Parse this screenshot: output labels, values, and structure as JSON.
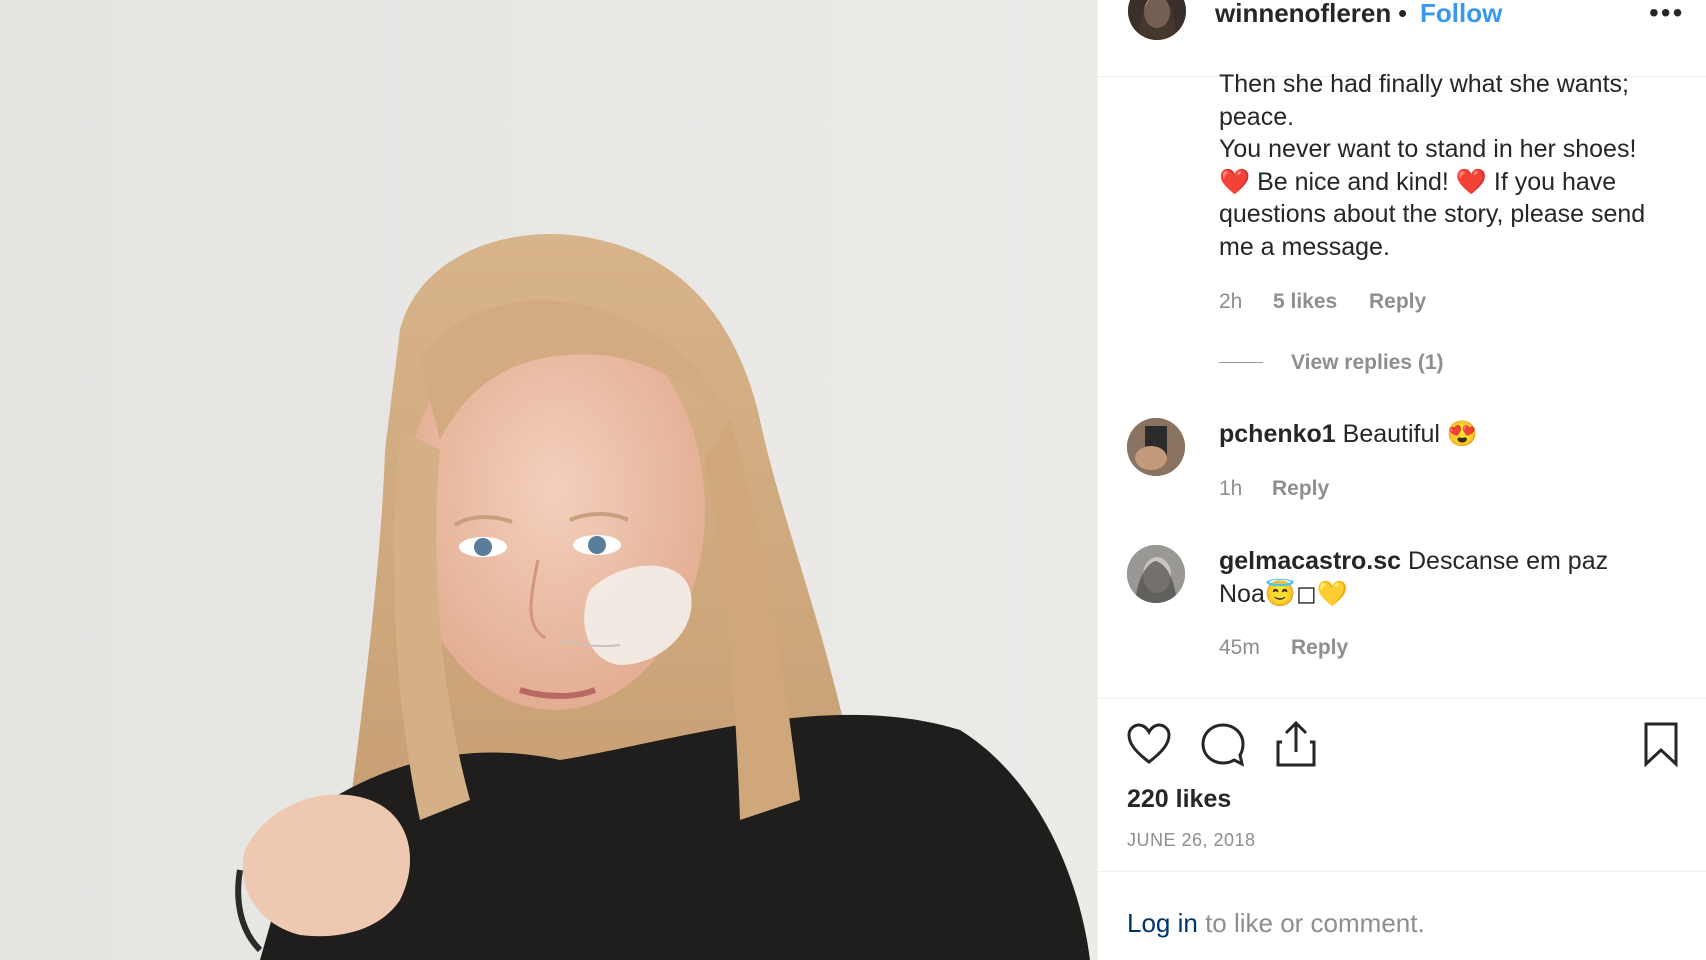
{
  "post": {
    "username": "winnenofleren",
    "dot": "•",
    "follow_label": "Follow",
    "more_label": "•••"
  },
  "comments": [
    {
      "lines": [
        "Then she had finally what she wants;",
        "peace.",
        "You never want to stand in her shoes!",
        "❤️ Be nice and kind! ❤️ If you have",
        "questions about the story, please send",
        "me a message."
      ],
      "time": "2h",
      "likes": "5 likes",
      "reply": "Reply",
      "view_replies": "View replies (1)"
    },
    {
      "username": "pchenko1",
      "text": "Beautiful 😍",
      "time": "1h",
      "reply": "Reply"
    },
    {
      "username": "gelmacastro.sc",
      "text": "Descanse em paz",
      "text2": "Noa😇◻💛",
      "time": "45m",
      "reply": "Reply"
    }
  ],
  "footer": {
    "likes": "220 likes",
    "date": "JUNE 26, 2018",
    "login_link": "Log in",
    "login_rest": " to like or comment."
  },
  "icons": [
    "heart-icon",
    "comment-icon",
    "share-icon",
    "bookmark-icon"
  ],
  "colors": {
    "link": "#3897f0",
    "muted": "#8e8e8e",
    "text": "#262626",
    "login": "#003569"
  }
}
